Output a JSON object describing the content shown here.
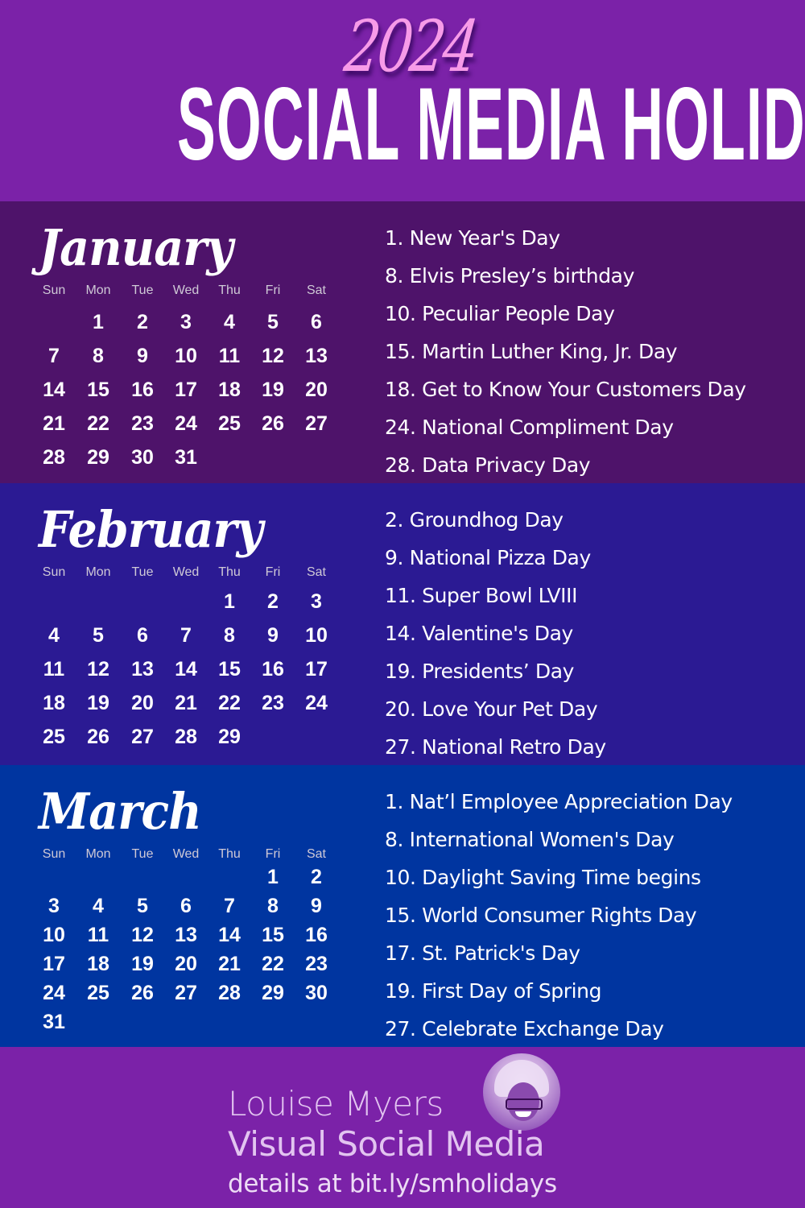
{
  "header": {
    "year": "2024",
    "title": "SOCIAL MEDIA HOLIDAYS"
  },
  "colors": {
    "header_bg": "#7b22a8",
    "january_bg": "#4e136a",
    "february_bg": "#2b1a93",
    "march_bg": "#0035a0",
    "footer_bg": "#7b22a8",
    "year_pink": "#f79be8"
  },
  "weekdays": [
    "Sun",
    "Mon",
    "Tue",
    "Wed",
    "Thu",
    "Fri",
    "Sat"
  ],
  "months": [
    {
      "name": "January",
      "first_weekday": 1,
      "days": 31,
      "holidays": [
        "1. New Year's Day",
        "8. Elvis Presley’s birthday",
        "10. Peculiar People Day",
        "15. Martin Luther King, Jr. Day",
        "18. Get to Know Your Customers Day",
        "24. National Compliment Day",
        "28. Data Privacy Day"
      ]
    },
    {
      "name": "February",
      "first_weekday": 4,
      "days": 29,
      "holidays": [
        "2. Groundhog Day",
        "9. National Pizza Day",
        "11. Super Bowl LVIII",
        "14. Valentine's Day",
        "19. Presidents’ Day",
        "20. Love Your Pet Day",
        "27. National Retro Day"
      ]
    },
    {
      "name": "March",
      "first_weekday": 5,
      "days": 31,
      "holidays": [
        "1. Nat’l Employee Appreciation Day",
        "8. International Women's Day",
        "10. Daylight Saving Time begins",
        "15. World Consumer Rights Day",
        "17. St. Patrick's Day",
        "19. First Day of Spring",
        "27. Celebrate Exchange Day"
      ]
    }
  ],
  "footer": {
    "author": "Louise Myers",
    "brand": "Visual Social Media",
    "details": "details at bit.ly/smholidays",
    "avatar_icon": "author-photo"
  }
}
